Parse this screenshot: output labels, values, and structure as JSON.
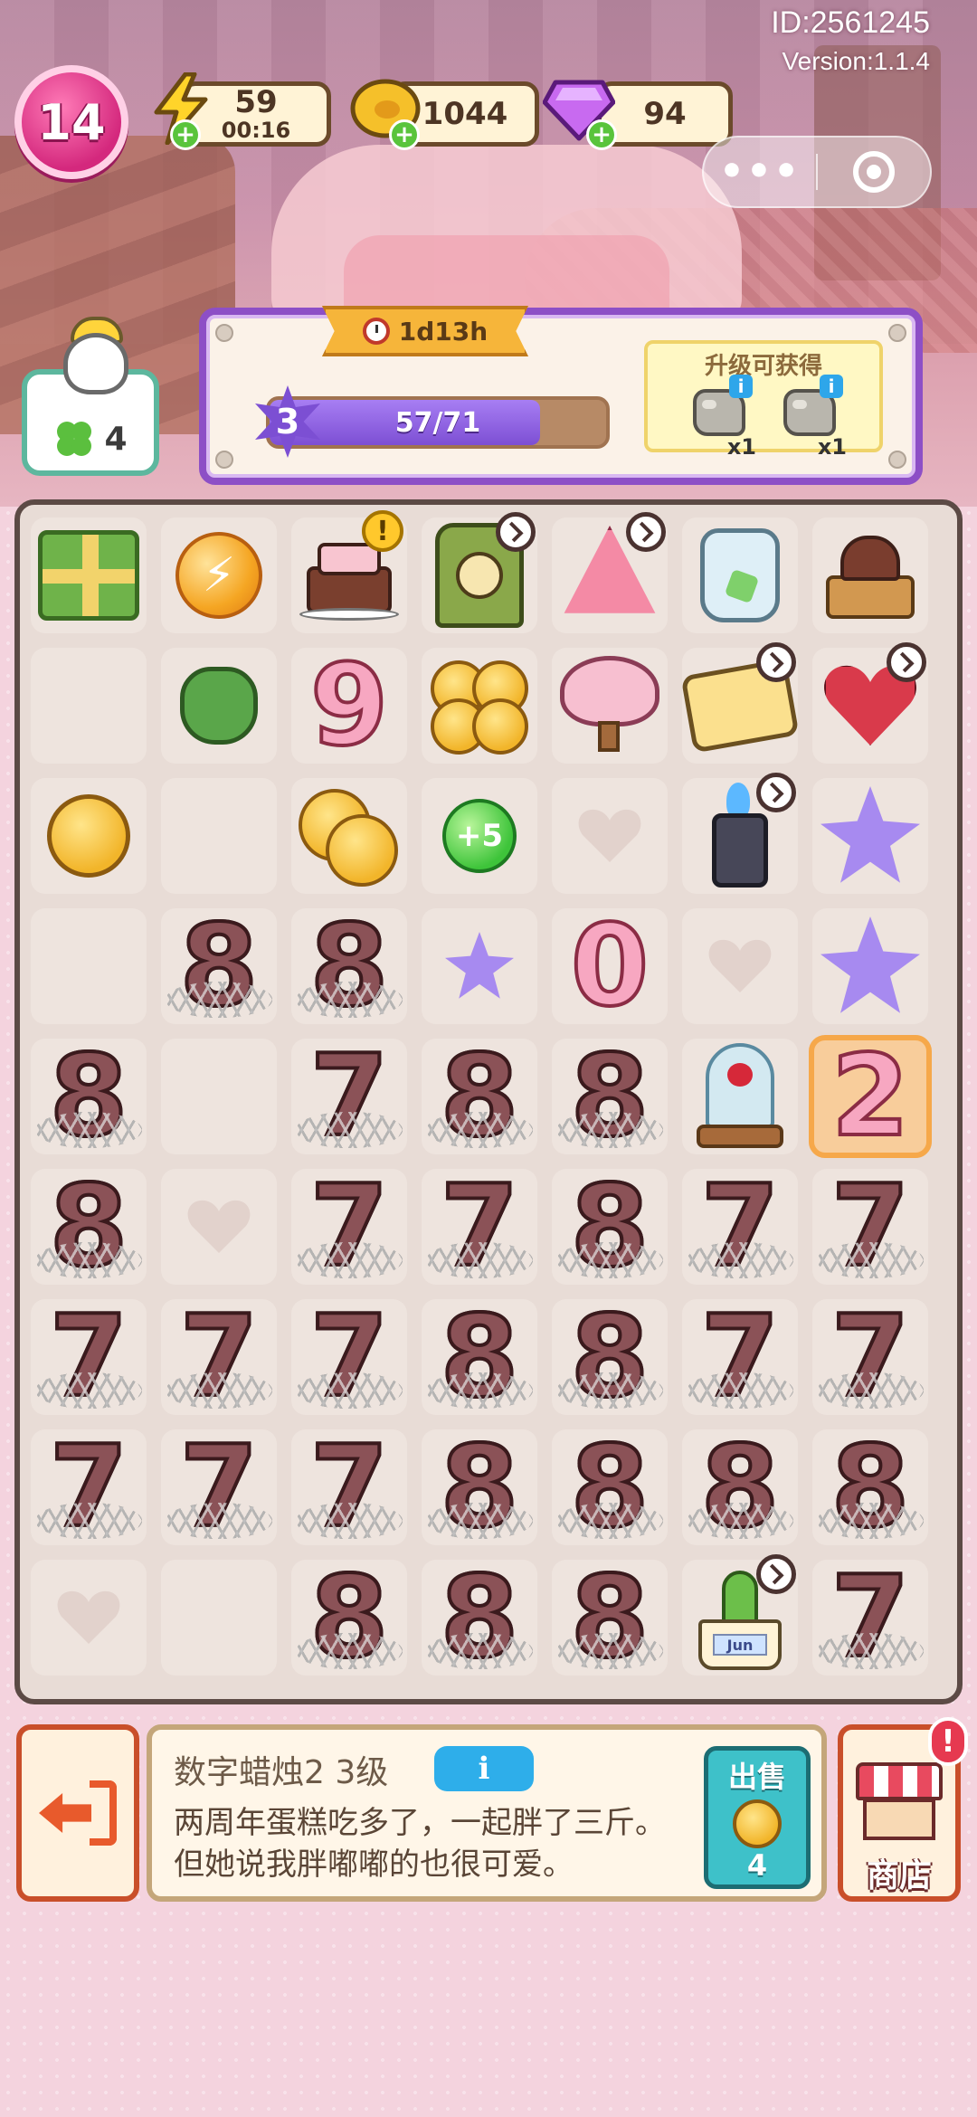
{
  "header": {
    "player_level": "14",
    "energy": {
      "value": "59",
      "timer": "00:16"
    },
    "coins": "1044",
    "gems": "94",
    "player_id": "ID:2561245",
    "version": "Version:1.1.4"
  },
  "guest": {
    "count": "4"
  },
  "quest": {
    "timer": "1d13h",
    "stage": "3",
    "progress_text": "57/71",
    "progress": 0.803,
    "reward_title": "升级可获得",
    "rewards": [
      {
        "qty": "x1"
      },
      {
        "qty": "x1"
      }
    ]
  },
  "board": {
    "rows": [
      [
        "gift-box",
        "energy-orb",
        "cake-generator",
        "clock-generator",
        "pink-tree-generator",
        "jar",
        "music-box"
      ],
      [
        "empty",
        "money-sack",
        "candle-9",
        "coin-stack-large",
        "blossom-tree",
        "duck-tablet",
        "heart-bandage"
      ],
      [
        "coin",
        "empty",
        "coin-stack-small",
        "plus5-orb",
        "heart-slot",
        "lighter",
        "purple-star"
      ],
      [
        "empty",
        "candle-8-burnt",
        "candle-8-burnt",
        "purple-star-small",
        "candle-0",
        "heart-slot",
        "purple-star"
      ],
      [
        "candle-8-burnt",
        "empty",
        "candle-7-burnt",
        "candle-8-burnt",
        "candle-8-burnt",
        "rose-dome",
        "candle-2-selected"
      ],
      [
        "candle-8-burnt",
        "heart-slot",
        "candle-7-burnt",
        "candle-7-burnt",
        "candle-8-burnt",
        "candle-7-burnt",
        "candle-7-burnt"
      ],
      [
        "candle-7-burnt",
        "candle-7-burnt",
        "candle-7-burnt",
        "candle-8-burnt",
        "candle-8-burnt",
        "candle-7-burnt",
        "candle-7-burnt"
      ],
      [
        "candle-7-burnt",
        "candle-7-burnt",
        "candle-7-burnt",
        "candle-8-burnt",
        "candle-8-burnt",
        "candle-8-burnt",
        "candle-8-burnt"
      ],
      [
        "heart-slot",
        "empty",
        "candle-8-burnt",
        "candle-8-burnt",
        "candle-8-burnt",
        "cactus-pot",
        "candle-7-burnt"
      ]
    ],
    "candle_digits": {
      "nine": "9",
      "zero": "0",
      "two": "2",
      "seven": "7",
      "eight": "8"
    },
    "plus5_label": "+5",
    "cactus_label": "Jun"
  },
  "info": {
    "title": "数字蜡烛2 3级",
    "info_button": "i",
    "description": "两周年蛋糕吃多了，一起胖了三斤。但她说我胖嘟嘟的也很可爱。",
    "sell_label": "出售",
    "sell_value": "4"
  },
  "shop": {
    "label": "商店",
    "alert": "!"
  },
  "icons": {
    "energy": "lightning-icon",
    "coin": "coin-icon",
    "gem": "gem-icon",
    "plus": "plus-icon",
    "exit": "exit-icon",
    "shop": "shop-icon"
  },
  "colors": {
    "accent_purple": "#8d4fc6",
    "selection": "#f6a84a",
    "sell_teal": "#3ec1c9"
  }
}
